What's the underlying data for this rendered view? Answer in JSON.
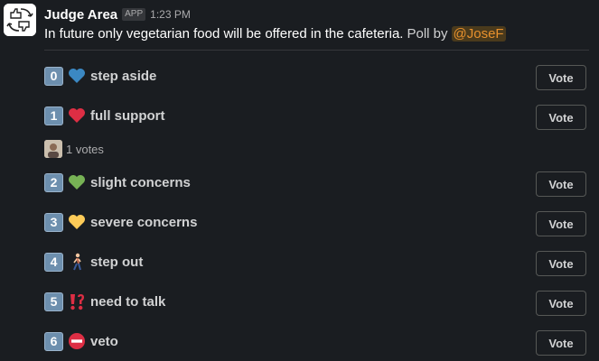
{
  "header": {
    "app_name": "Judge Area",
    "badge": "APP",
    "timestamp": "1:23 PM"
  },
  "message": {
    "question": "In future only vegetarian food will be offered in the cafeteria.",
    "poll_by": "Poll by",
    "mention": "@JoseF"
  },
  "options": [
    {
      "number": "0",
      "emoji": "blue-heart-icon",
      "label": "step aside",
      "vote_label": "Vote"
    },
    {
      "number": "1",
      "emoji": "red-heart-icon",
      "label": "full support",
      "vote_label": "Vote"
    },
    {
      "number": "2",
      "emoji": "green-heart-icon",
      "label": "slight concerns",
      "vote_label": "Vote"
    },
    {
      "number": "3",
      "emoji": "yellow-heart-icon",
      "label": "severe concerns",
      "vote_label": "Vote"
    },
    {
      "number": "4",
      "emoji": "person-walking-icon",
      "label": "step out",
      "vote_label": "Vote"
    },
    {
      "number": "5",
      "emoji": "double-exclamation-icon",
      "label": "need to talk",
      "vote_label": "Vote"
    },
    {
      "number": "6",
      "emoji": "no-entry-icon",
      "label": "veto",
      "vote_label": "Vote"
    }
  ],
  "votes": {
    "option_1": "1 votes"
  },
  "colors": {
    "background": "#1a1d21",
    "mention": "#e8912d",
    "badge": "#6d8fae"
  }
}
